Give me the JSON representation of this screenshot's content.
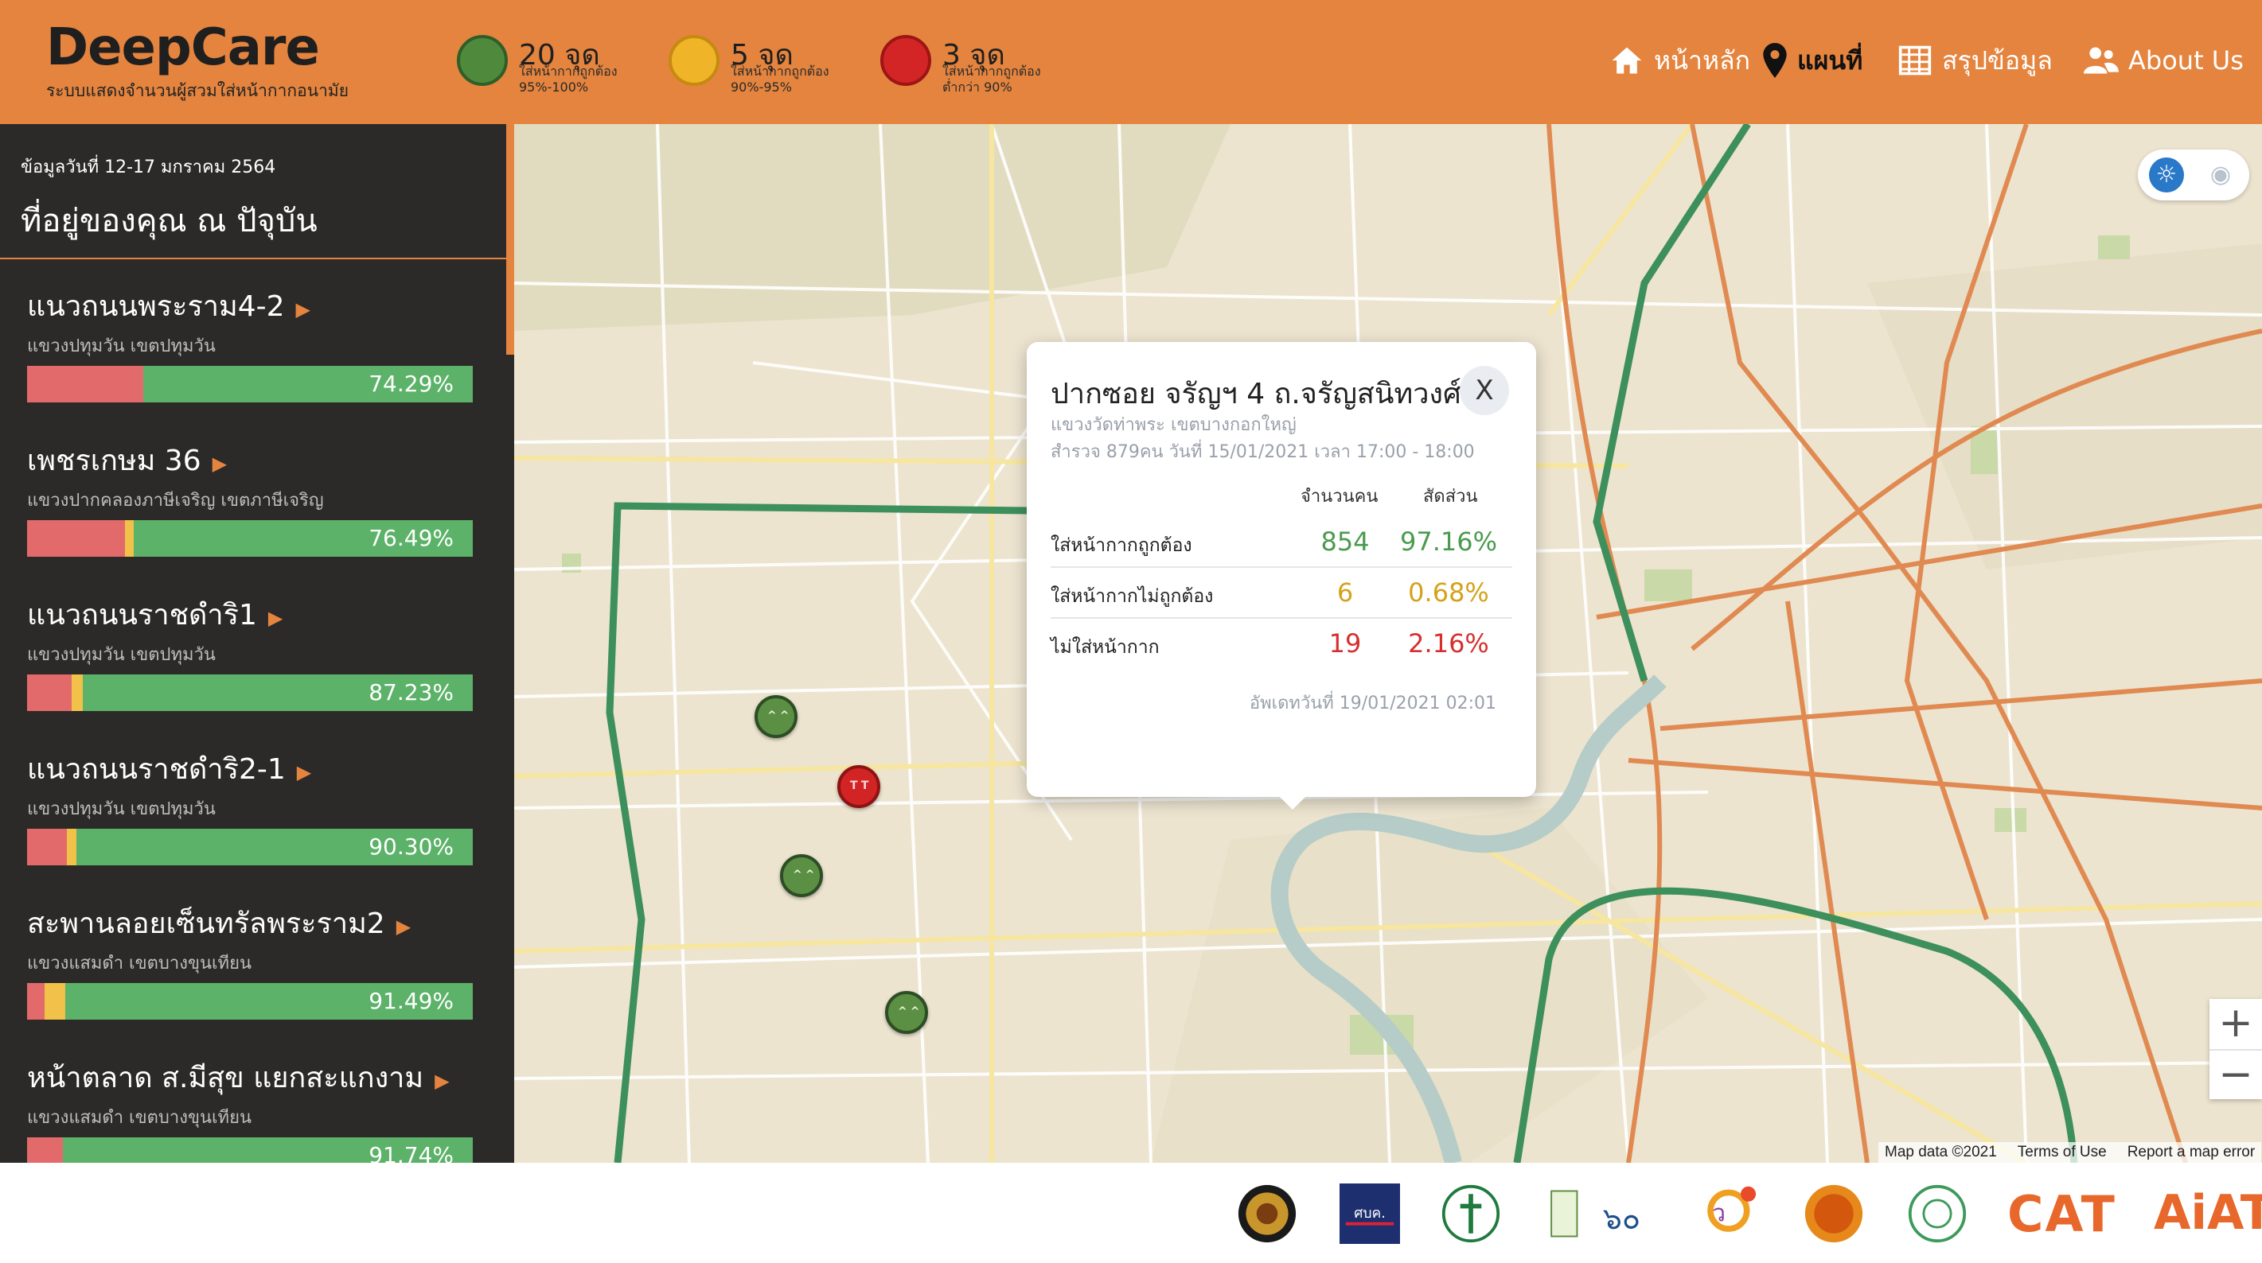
{
  "brand": {
    "title": "DeepCare",
    "subtitle": "ระบบแสดงจำนวนผู้สวมใส่หน้ากากอนามัย"
  },
  "legend": [
    {
      "count": "20 จุด",
      "line1": "ใส่หน้ากากถูกต้อง",
      "line2": "95%-100%",
      "icon": "green-smile-face-icon",
      "color": "#4f8a3c"
    },
    {
      "count": "5 จุด",
      "line1": "ใส่หน้ากากถูกต้อง",
      "line2": "90%-95%",
      "icon": "yellow-neutral-face-icon",
      "color": "#f0b429"
    },
    {
      "count": "3 จุด",
      "line1": "ใส่หน้ากากถูกต้อง",
      "line2": "ต่ำกว่า 90%",
      "icon": "red-sad-face-icon",
      "color": "#d32525"
    }
  ],
  "nav": {
    "home": "หน้าหลัก",
    "map": "แผนที่",
    "summary": "สรุปข้อมูล",
    "about": "About Us"
  },
  "sidebar": {
    "date": "ข้อมูลวันที่ 12-17 มกราคม 2564",
    "title": "ที่อยู่ของคุณ ณ ปัจุบัน",
    "locations": [
      {
        "name": "แนวถนนพระราม4-2",
        "district": "แขวงปทุมวัน เขตปทุมวัน",
        "percent": "74.29%",
        "red": 0.26,
        "yellow": 0.0
      },
      {
        "name": "เพชรเกษม 36",
        "district": "แขวงปากคลองภาษีเจริญ เขตภาษีเจริญ",
        "percent": "76.49%",
        "red": 0.22,
        "yellow": 0.02
      },
      {
        "name": "แนวถนนราชดำริ1",
        "district": "แขวงปทุมวัน เขตปทุมวัน",
        "percent": "87.23%",
        "red": 0.1,
        "yellow": 0.025
      },
      {
        "name": "แนวถนนราชดำริ2-1",
        "district": "แขวงปทุมวัน เขตปทุมวัน",
        "percent": "90.30%",
        "red": 0.09,
        "yellow": 0.02
      },
      {
        "name": "สะพานลอยเซ็นทรัลพระราม2",
        "district": "แขวงแสมดำ เขตบางขุนเทียน",
        "percent": "91.49%",
        "red": 0.04,
        "yellow": 0.045
      },
      {
        "name": "หน้าตลาด ส.มีสุข แยกสะแกงาม",
        "district": "แขวงแสมดำ เขตบางขุนเทียน",
        "percent": "91.74%",
        "red": 0.08,
        "yellow": 0.0
      }
    ]
  },
  "popup": {
    "title": "ปากซอย จรัญฯ 4 ถ.จรัญสนิทวงศ์",
    "close": "X",
    "district": "แขวงวัดท่าพระ เขตบางกอกใหญ่",
    "survey": "สำรวจ 879คน วันที่ 15/01/2021 เวลา 17:00 - 18:00",
    "col_count": "จำนวนคน",
    "col_ratio": "สัดส่วน",
    "rows": [
      {
        "label": "ใส่หน้ากากถูกต้อง",
        "count": "854",
        "ratio": "97.16%",
        "color": "#4b9a4e"
      },
      {
        "label": "ใส่หน้ากากไม่ถูกต้อง",
        "count": "6",
        "ratio": "0.68%",
        "color": "#d4a21a"
      },
      {
        "label": "ไม่ใส่หน้ากาก",
        "count": "19",
        "ratio": "2.16%",
        "color": "#d62f2f"
      }
    ],
    "updated": "อัพเดทวันที่ 19/01/2021 02:01"
  },
  "map": {
    "zoom_in": "+",
    "zoom_out": "−",
    "attribution": [
      "Map data ©2021",
      "Terms of Use",
      "Report a map error"
    ]
  },
  "footer": {
    "logos": [
      "police-seal-logo",
      "covid-center-logo",
      "public-health-logo",
      "5g-logo",
      "anniversary-logo",
      "university-seal-logo",
      "bma-logo",
      "cat-logo",
      "aiat-logo"
    ],
    "cat": "CAT",
    "aiat": "AiAT"
  }
}
